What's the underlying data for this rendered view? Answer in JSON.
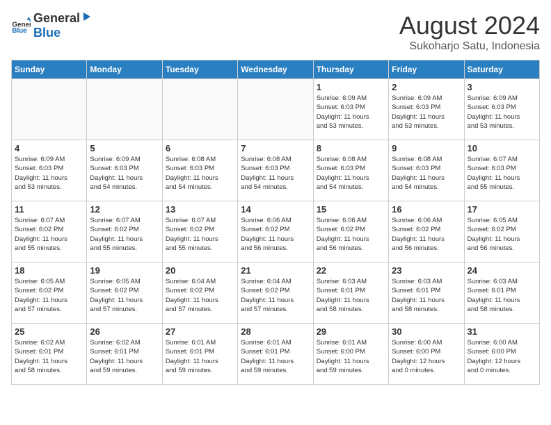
{
  "logo": {
    "general": "General",
    "blue": "Blue"
  },
  "title": "August 2024",
  "location": "Sukoharjo Satu, Indonesia",
  "days_of_week": [
    "Sunday",
    "Monday",
    "Tuesday",
    "Wednesday",
    "Thursday",
    "Friday",
    "Saturday"
  ],
  "weeks": [
    [
      {
        "day": "",
        "info": ""
      },
      {
        "day": "",
        "info": ""
      },
      {
        "day": "",
        "info": ""
      },
      {
        "day": "",
        "info": ""
      },
      {
        "day": "1",
        "info": "Sunrise: 6:09 AM\nSunset: 6:03 PM\nDaylight: 11 hours\nand 53 minutes."
      },
      {
        "day": "2",
        "info": "Sunrise: 6:09 AM\nSunset: 6:03 PM\nDaylight: 11 hours\nand 53 minutes."
      },
      {
        "day": "3",
        "info": "Sunrise: 6:09 AM\nSunset: 6:03 PM\nDaylight: 11 hours\nand 53 minutes."
      }
    ],
    [
      {
        "day": "4",
        "info": "Sunrise: 6:09 AM\nSunset: 6:03 PM\nDaylight: 11 hours\nand 53 minutes."
      },
      {
        "day": "5",
        "info": "Sunrise: 6:09 AM\nSunset: 6:03 PM\nDaylight: 11 hours\nand 54 minutes."
      },
      {
        "day": "6",
        "info": "Sunrise: 6:08 AM\nSunset: 6:03 PM\nDaylight: 11 hours\nand 54 minutes."
      },
      {
        "day": "7",
        "info": "Sunrise: 6:08 AM\nSunset: 6:03 PM\nDaylight: 11 hours\nand 54 minutes."
      },
      {
        "day": "8",
        "info": "Sunrise: 6:08 AM\nSunset: 6:03 PM\nDaylight: 11 hours\nand 54 minutes."
      },
      {
        "day": "9",
        "info": "Sunrise: 6:08 AM\nSunset: 6:03 PM\nDaylight: 11 hours\nand 54 minutes."
      },
      {
        "day": "10",
        "info": "Sunrise: 6:07 AM\nSunset: 6:03 PM\nDaylight: 11 hours\nand 55 minutes."
      }
    ],
    [
      {
        "day": "11",
        "info": "Sunrise: 6:07 AM\nSunset: 6:02 PM\nDaylight: 11 hours\nand 55 minutes."
      },
      {
        "day": "12",
        "info": "Sunrise: 6:07 AM\nSunset: 6:02 PM\nDaylight: 11 hours\nand 55 minutes."
      },
      {
        "day": "13",
        "info": "Sunrise: 6:07 AM\nSunset: 6:02 PM\nDaylight: 11 hours\nand 55 minutes."
      },
      {
        "day": "14",
        "info": "Sunrise: 6:06 AM\nSunset: 6:02 PM\nDaylight: 11 hours\nand 56 minutes."
      },
      {
        "day": "15",
        "info": "Sunrise: 6:06 AM\nSunset: 6:02 PM\nDaylight: 11 hours\nand 56 minutes."
      },
      {
        "day": "16",
        "info": "Sunrise: 6:06 AM\nSunset: 6:02 PM\nDaylight: 11 hours\nand 56 minutes."
      },
      {
        "day": "17",
        "info": "Sunrise: 6:05 AM\nSunset: 6:02 PM\nDaylight: 11 hours\nand 56 minutes."
      }
    ],
    [
      {
        "day": "18",
        "info": "Sunrise: 6:05 AM\nSunset: 6:02 PM\nDaylight: 11 hours\nand 57 minutes."
      },
      {
        "day": "19",
        "info": "Sunrise: 6:05 AM\nSunset: 6:02 PM\nDaylight: 11 hours\nand 57 minutes."
      },
      {
        "day": "20",
        "info": "Sunrise: 6:04 AM\nSunset: 6:02 PM\nDaylight: 11 hours\nand 57 minutes."
      },
      {
        "day": "21",
        "info": "Sunrise: 6:04 AM\nSunset: 6:02 PM\nDaylight: 11 hours\nand 57 minutes."
      },
      {
        "day": "22",
        "info": "Sunrise: 6:03 AM\nSunset: 6:01 PM\nDaylight: 11 hours\nand 58 minutes."
      },
      {
        "day": "23",
        "info": "Sunrise: 6:03 AM\nSunset: 6:01 PM\nDaylight: 11 hours\nand 58 minutes."
      },
      {
        "day": "24",
        "info": "Sunrise: 6:03 AM\nSunset: 6:01 PM\nDaylight: 11 hours\nand 58 minutes."
      }
    ],
    [
      {
        "day": "25",
        "info": "Sunrise: 6:02 AM\nSunset: 6:01 PM\nDaylight: 11 hours\nand 58 minutes."
      },
      {
        "day": "26",
        "info": "Sunrise: 6:02 AM\nSunset: 6:01 PM\nDaylight: 11 hours\nand 59 minutes."
      },
      {
        "day": "27",
        "info": "Sunrise: 6:01 AM\nSunset: 6:01 PM\nDaylight: 11 hours\nand 59 minutes."
      },
      {
        "day": "28",
        "info": "Sunrise: 6:01 AM\nSunset: 6:01 PM\nDaylight: 11 hours\nand 59 minutes."
      },
      {
        "day": "29",
        "info": "Sunrise: 6:01 AM\nSunset: 6:00 PM\nDaylight: 11 hours\nand 59 minutes."
      },
      {
        "day": "30",
        "info": "Sunrise: 6:00 AM\nSunset: 6:00 PM\nDaylight: 12 hours\nand 0 minutes."
      },
      {
        "day": "31",
        "info": "Sunrise: 6:00 AM\nSunset: 6:00 PM\nDaylight: 12 hours\nand 0 minutes."
      }
    ]
  ]
}
